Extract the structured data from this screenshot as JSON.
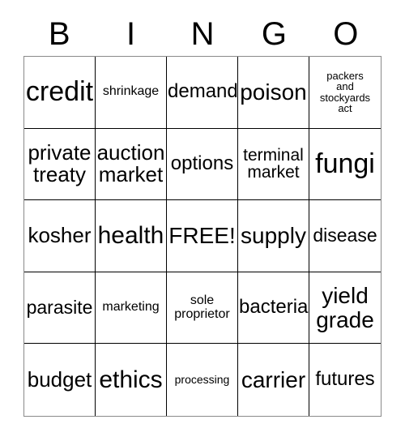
{
  "header": {
    "letters": [
      "B",
      "I",
      "N",
      "G",
      "O"
    ]
  },
  "grid": {
    "rows": [
      {
        "cells": [
          {
            "text": "credit",
            "size": "fs-34"
          },
          {
            "text": "shrinkage",
            "size": "fs-16"
          },
          {
            "text": "demand",
            "size": "fs-24"
          },
          {
            "text": "poison",
            "size": "fs-28"
          },
          {
            "text": "packers\nand\nstockyards\nact",
            "size": "fs-13"
          }
        ]
      },
      {
        "cells": [
          {
            "text": "private\ntreaty",
            "size": "fs-26"
          },
          {
            "text": "auction\nmarket",
            "size": "fs-26"
          },
          {
            "text": "options",
            "size": "fs-24"
          },
          {
            "text": "terminal\nmarket",
            "size": "fs-21"
          },
          {
            "text": "fungi",
            "size": "fs-34"
          }
        ]
      },
      {
        "cells": [
          {
            "text": "kosher",
            "size": "fs-26"
          },
          {
            "text": "health",
            "size": "fs-30"
          },
          {
            "text": "FREE!",
            "size": "fs-28"
          },
          {
            "text": "supply",
            "size": "fs-28"
          },
          {
            "text": "disease",
            "size": "fs-23"
          }
        ]
      },
      {
        "cells": [
          {
            "text": "parasite",
            "size": "fs-23"
          },
          {
            "text": "marketing",
            "size": "fs-16"
          },
          {
            "text": "sole\nproprietor",
            "size": "fs-16"
          },
          {
            "text": "bacteria",
            "size": "fs-24"
          },
          {
            "text": "yield\ngrade",
            "size": "fs-28"
          }
        ]
      },
      {
        "cells": [
          {
            "text": "budget",
            "size": "fs-26"
          },
          {
            "text": "ethics",
            "size": "fs-30"
          },
          {
            "text": "processing",
            "size": "fs-14"
          },
          {
            "text": "carrier",
            "size": "fs-28"
          },
          {
            "text": "futures",
            "size": "fs-24"
          }
        ]
      }
    ]
  },
  "colors": {
    "background": "#ffffff",
    "text": "#000000",
    "inner_border": "#000000",
    "outer_border": "#8a8a8a"
  }
}
